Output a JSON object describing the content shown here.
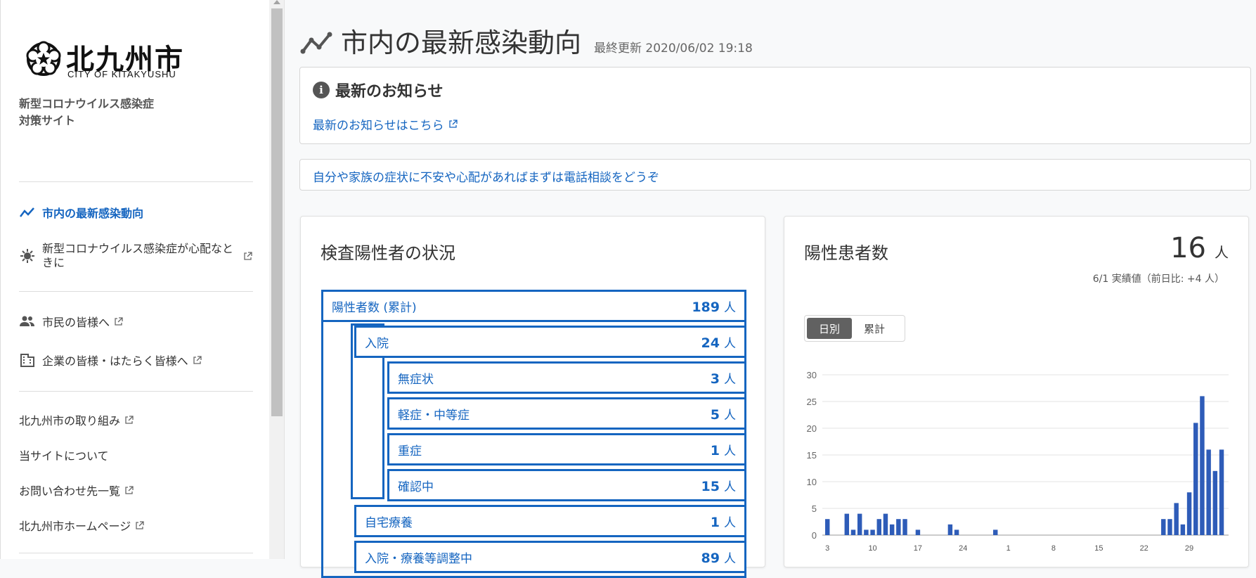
{
  "sidebar": {
    "logo_kanji": "北九州市",
    "logo_roman": "CITY OF KITAKYUSHU",
    "site_title_line1": "新型コロナウイルス感染症",
    "site_title_line2": "対策サイト",
    "nav": [
      {
        "label": "市内の最新感染動向",
        "icon": "chart-line-icon",
        "active": true
      },
      {
        "label": "新型コロナウイルス感染症が心配なときに",
        "icon": "virus-icon",
        "external": true
      },
      {
        "label": "市民の皆様へ",
        "icon": "people-icon",
        "external": true
      },
      {
        "label": "企業の皆様・はたらく皆様へ",
        "icon": "building-icon",
        "external": true
      },
      {
        "label": "北九州市の取り組み",
        "external": true
      },
      {
        "label": "当サイトについて"
      },
      {
        "label": "お問い合わせ先一覧",
        "external": true
      },
      {
        "label": "北九州市ホームページ",
        "external": true
      }
    ]
  },
  "header": {
    "title": "市内の最新感染動向",
    "last_updated": "最終更新 2020/06/02 19:18"
  },
  "news": {
    "title": "最新のお知らせ",
    "link": "最新のお知らせはこちら"
  },
  "consult": {
    "link": "自分や家族の症状に不安や心配があればまずは電話相談をどうぞ"
  },
  "status": {
    "title": "検査陽性者の状況",
    "unit": "人",
    "rows": [
      {
        "name": "陽性者数 (累計)",
        "value": "189"
      },
      {
        "name": "入院",
        "value": "24"
      },
      {
        "name": "無症状",
        "value": "3"
      },
      {
        "name": "軽症・中等症",
        "value": "5"
      },
      {
        "name": "重症",
        "value": "1"
      },
      {
        "name": "確認中",
        "value": "15"
      },
      {
        "name": "自宅療養",
        "value": "1"
      },
      {
        "name": "入院・療養等調整中",
        "value": "89"
      }
    ]
  },
  "patients": {
    "title": "陽性患者数",
    "count": "16",
    "unit": "人",
    "sub": "6/1 実績値（前日比: +4 人）",
    "toggle": [
      "日別",
      "累計"
    ],
    "toggle_selected": "日別"
  },
  "colors": {
    "accent": "#1565c0",
    "bar": "#2e5cb8"
  },
  "chart_data": {
    "type": "bar",
    "ylim": [
      0,
      30
    ],
    "yticks": [
      0,
      5,
      10,
      15,
      20,
      25,
      30
    ],
    "xticks": [
      "3",
      "10",
      "17",
      "24",
      "1",
      "8",
      "15",
      "22",
      "29"
    ],
    "values": [
      3,
      0,
      0,
      4,
      1,
      4,
      1,
      1,
      3,
      4,
      2,
      3,
      3,
      0,
      1,
      0,
      0,
      0,
      0,
      2,
      1,
      0,
      0,
      0,
      0,
      0,
      1,
      0,
      0,
      0,
      0,
      0,
      0,
      0,
      0,
      0,
      0,
      0,
      0,
      0,
      0,
      0,
      0,
      0,
      0,
      0,
      0,
      0,
      0,
      0,
      0,
      0,
      3,
      3,
      6,
      2,
      8,
      21,
      26,
      16,
      12,
      16
    ]
  }
}
